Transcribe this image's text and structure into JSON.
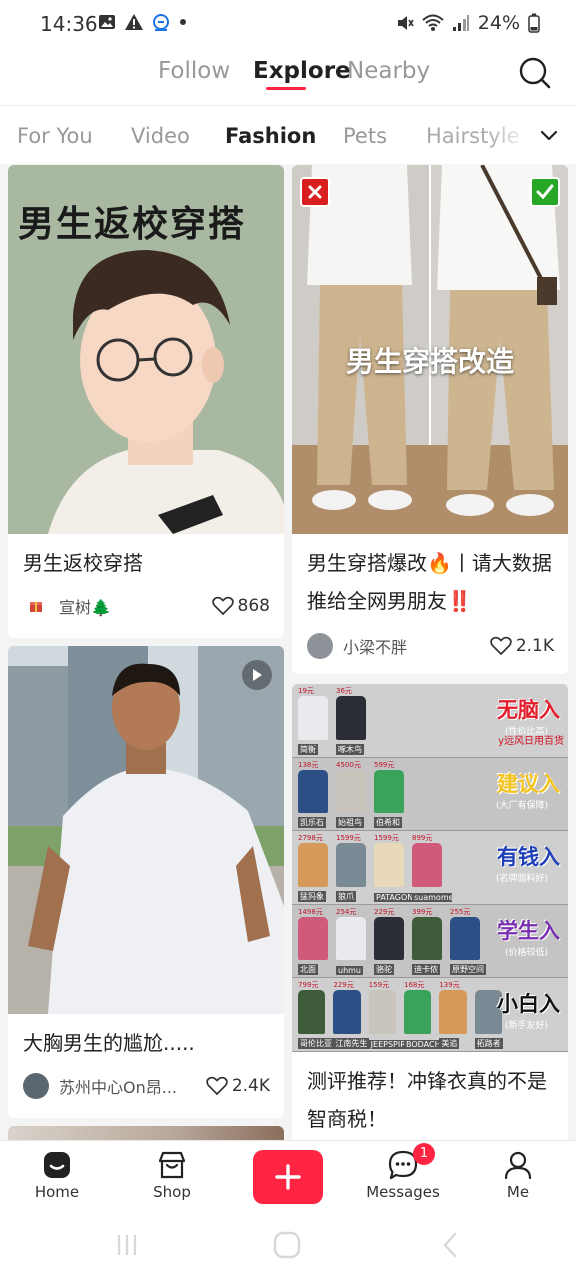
{
  "status_bar": {
    "time": "14:36",
    "battery": "24%",
    "icons": [
      "gallery-icon",
      "warning-icon",
      "app-icon",
      "dot-icon",
      "mute-icon",
      "wifi-icon",
      "signal-icon",
      "battery-icon"
    ]
  },
  "top_nav": {
    "tabs": [
      {
        "label": "Follow"
      },
      {
        "label": "Explore"
      },
      {
        "label": "Nearby"
      }
    ],
    "active": "Explore"
  },
  "categories": {
    "items": [
      "For You",
      "Video",
      "Fashion",
      "Pets",
      "Hairstyle"
    ],
    "active": "Fashion"
  },
  "feed": {
    "cards": [
      {
        "image_text": "男生返校穿搭",
        "title": "男生返校穿搭",
        "author": "宣树🌲",
        "likes": "868"
      },
      {
        "image_text": "男生穿搭改造",
        "title": "男生穿搭爆改🔥丨请大数据推给全网男朋友‼️",
        "author": "小梁不胖",
        "likes": "2.1K"
      },
      {
        "title": "大胸男生的尴尬.....",
        "author": "苏州中心On昂...",
        "likes": "2.4K"
      },
      {
        "image_sections": [
          {
            "heading": "无脑入",
            "sub": "(性价比高)",
            "side": "y远风日用百货",
            "brands": [
              "简衡",
              "啄木鸟"
            ],
            "prices": [
              "19元",
              "36元"
            ]
          },
          {
            "heading": "建议入",
            "sub": "(大厂有保障)",
            "brands": [
              "凯乐石",
              "始祖鸟",
              "伯希和"
            ],
            "prices": [
              "138元",
              "4500元",
              "599元"
            ]
          },
          {
            "heading": "有钱入",
            "sub": "(名牌面料好)",
            "brands": [
              "猛犸象",
              "狼爪",
              "PATAGONIA",
              "suamoment"
            ],
            "prices": [
              "2798元",
              "1599元",
              "1599元",
              "899元"
            ]
          },
          {
            "heading": "学生入",
            "sub": "(价格较低)",
            "brands": [
              "北面",
              "uhmu",
              "骆驼",
              "迪卡侬",
              "原野空间"
            ],
            "prices": [
              "1498元",
              "254元",
              "229元",
              "399元",
              "255元"
            ]
          },
          {
            "heading": "小白入",
            "sub": "(新手友好)",
            "brands": [
              "哥伦比亚",
              "江南先生",
              "JEEPSPIRIT",
              "BODACHEL",
              "美追",
              "拓路者"
            ],
            "prices": [
              "799元",
              "229元",
              "159元",
              "168元",
              "139元"
            ]
          }
        ],
        "title": "测评推荐！冲锋衣真的不是智商税！"
      }
    ]
  },
  "bottom_nav": {
    "items": [
      {
        "label": "Home"
      },
      {
        "label": "Shop"
      },
      {
        "label": "Messages"
      },
      {
        "label": "Me"
      }
    ],
    "messages_badge": "1"
  },
  "colors": {
    "accent": "#ff2442",
    "text": "#222222",
    "muted": "#999999",
    "feed_bg": "#f4f4f5"
  }
}
